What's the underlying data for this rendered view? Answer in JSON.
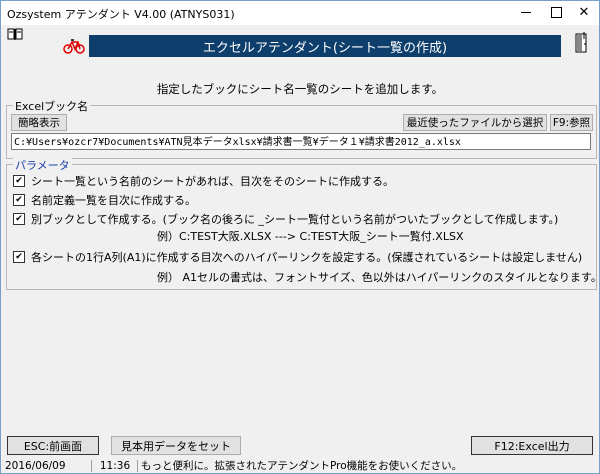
{
  "window": {
    "title": "Ozsystem アテンダント V4.00 (ATNYS031)",
    "controls": {
      "close": "✕"
    }
  },
  "header": {
    "banner": "エクセルアテンダント(シート一覧の作成)",
    "banner_color": "#0e3f6c"
  },
  "description": "指定したブックにシート名一覧のシートを追加します。",
  "file_group": {
    "legend": "Excelブック名",
    "short_display_label": "簡略表示",
    "recent_label": "最近使ったファイルから選択",
    "browse_label": "F9:参照",
    "path": "C:¥Users¥ozcr7¥Documents¥ATN見本データxlsx¥請求書一覧¥データ１¥請求書2012_a.xlsx"
  },
  "params": {
    "legend": "パラメータ",
    "options": [
      {
        "label": "シート一覧という名前のシートがあれば、目次をそのシートに作成する。",
        "checked": true
      },
      {
        "label": "名前定義一覧を目次に作成する。",
        "checked": true
      },
      {
        "label": "別ブックとして作成する。(ブック名の後ろに _シート一覧付という名前がついたブックとして作成します。)",
        "checked": true
      },
      {
        "label": "各シートの1行A列(A1)に作成する目次へのハイパーリンクを設定する。(保護されているシートは設定しません)",
        "checked": true
      }
    ],
    "example1": "例）C:TEST大阪.XLSX ---> C:TEST大阪_シート一覧付.XLSX",
    "example2": "例） A1セルの書式は、フォントサイズ、色以外はハイパーリンクのスタイルとなります。"
  },
  "footer": {
    "esc_label": "ESC:前画面",
    "sample_label": "見本用データをセット",
    "excel_label": "F12:Excel出力"
  },
  "status": {
    "date": "2016/06/09",
    "time": "11:36",
    "message": "もっと便利に。拡張されたアテンダントPro機能をお使いください。"
  }
}
